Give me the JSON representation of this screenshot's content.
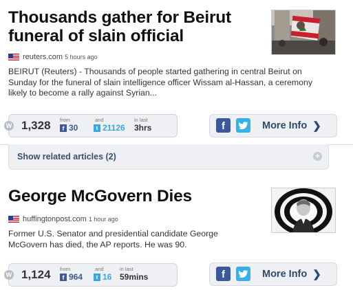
{
  "articles": [
    {
      "headline": "Thousands gather for Beirut funeral of slain official",
      "source": "reuters.com",
      "time": "5 hours ago",
      "summary": "BEIRUT (Reuters) - Thousands of people started gathering in central Beirut on Sunday for the funeral of slain intelligence officer Wissam al-Hassan, a ceremony likely to become a rally against Syrian...",
      "total": "1,328",
      "from_label": "from",
      "facebook_count": "30",
      "and_label": "and",
      "twitter_count": "21126",
      "in_last_label": "in last",
      "duration": "3hrs",
      "more_info_label": "More Info",
      "related_label": "Show related articles (2)"
    },
    {
      "headline": "George McGovern Dies",
      "source": "huffingtonpost.com",
      "time": "1 hour ago",
      "summary": "Former U.S. Senator and presidential candidate George McGovern has died, the AP reports. He was 90.",
      "total": "1,124",
      "from_label": "from",
      "facebook_count": "964",
      "and_label": "and",
      "twitter_count": "16",
      "in_last_label": "in last",
      "duration": "59mins",
      "more_info_label": "More Info"
    }
  ],
  "colors": {
    "facebook": "#3b5998",
    "twitter": "#37a8dc",
    "more_info": "#2f4a6f",
    "panel_bg": "#eef0f3"
  },
  "icons": {
    "flag": "us-flag-icon",
    "facebook": "facebook-icon",
    "twitter": "twitter-icon",
    "chevron": "chevron-right-icon",
    "plus": "plus-icon",
    "w": "w-icon"
  }
}
